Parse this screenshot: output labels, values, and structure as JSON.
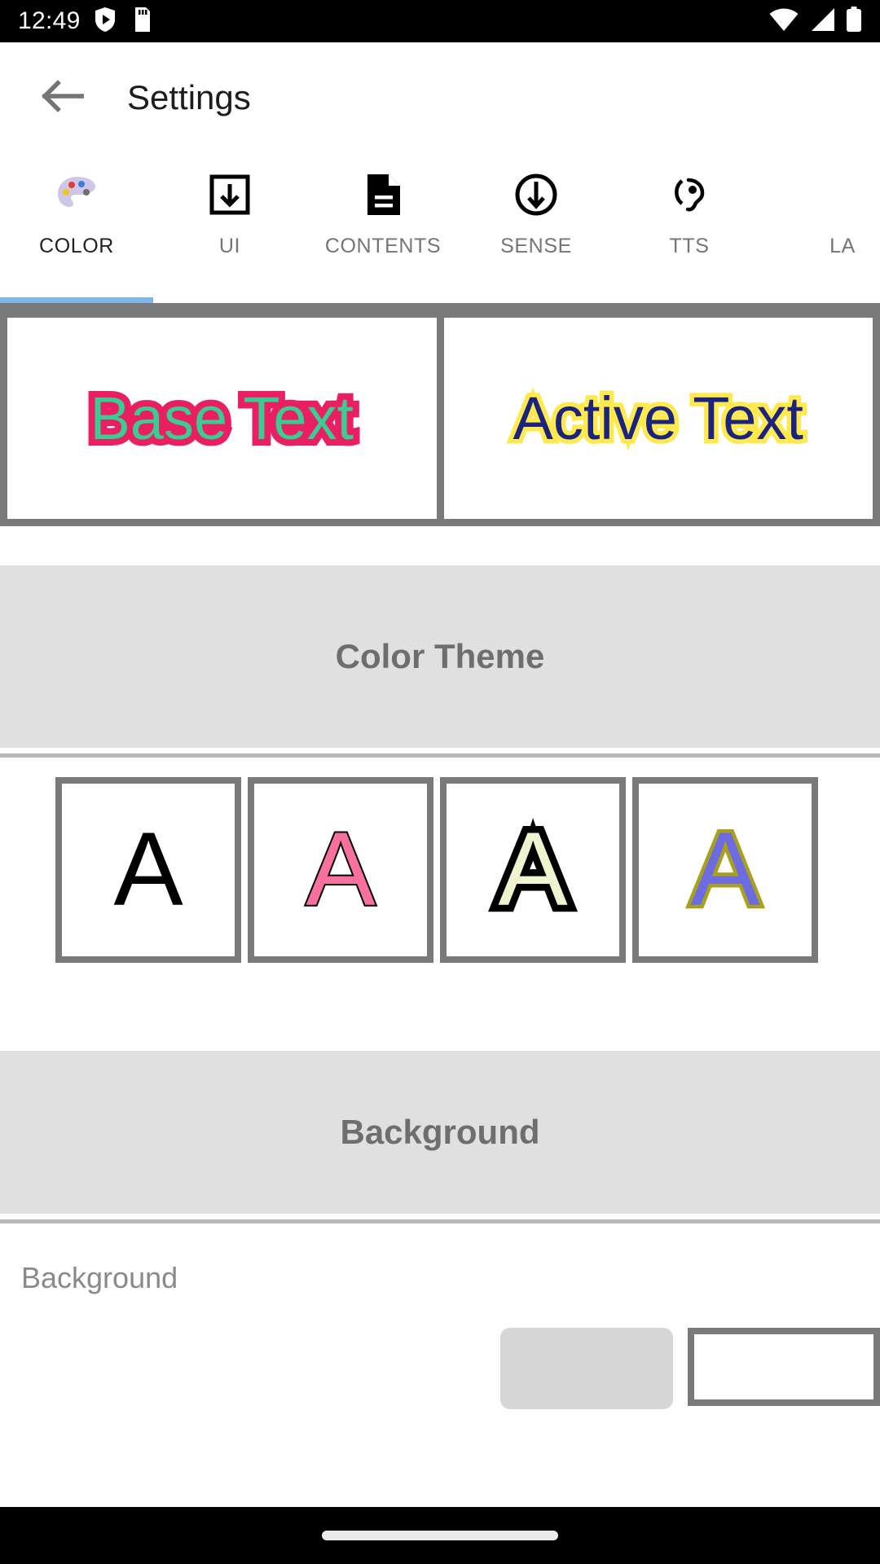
{
  "status_bar": {
    "clock": "12:49",
    "left_icons": [
      "shield-play-icon",
      "sd-card-icon"
    ],
    "right_icons": [
      "wifi-icon",
      "cellular-signal-icon",
      "battery-icon"
    ],
    "background_color": "#000000",
    "foreground_color": "#ffffff"
  },
  "toolbar": {
    "back_icon": "back-arrow-icon",
    "title": "Settings"
  },
  "tabs": {
    "active_index": 0,
    "indicator_color": "#7FB6E8",
    "items": [
      {
        "label": "COLOR",
        "icon": "palette-icon",
        "active": true
      },
      {
        "label": "UI",
        "icon": "download-box-icon",
        "active": false
      },
      {
        "label": "CONTENTS",
        "icon": "document-icon",
        "active": false
      },
      {
        "label": "SENSE",
        "icon": "circle-down-arrow-icon",
        "active": false
      },
      {
        "label": "TTS",
        "icon": "hearing-ear-icon",
        "active": false
      },
      {
        "label": "LA",
        "icon": "",
        "active": false
      }
    ]
  },
  "preview": {
    "base": {
      "text": "Base Text",
      "fill_color": "#3ACC93",
      "outline_color": "#E91E63"
    },
    "active": {
      "text": "Active Text",
      "fill_color": "#1A237E",
      "outline_color": "#FFE94D"
    }
  },
  "color_theme_section": {
    "title": "Color Theme",
    "swatches": [
      {
        "letter": "A",
        "fill_color": "#000000",
        "outline_color": "none",
        "name": "theme-black"
      },
      {
        "letter": "A",
        "fill_color": "#F8719D",
        "outline_color": "#000000",
        "name": "theme-pink"
      },
      {
        "letter": "A",
        "fill_color": "#EFF3CF",
        "outline_color": "#000000",
        "name": "theme-cream"
      },
      {
        "letter": "A",
        "fill_color": "#6C6CE0",
        "outline_color": "#A8A01E",
        "name": "theme-blue"
      }
    ]
  },
  "background_section": {
    "title": "Background",
    "row_label": "Background",
    "button_label": "",
    "chip_label": ""
  },
  "nav_bar": {
    "gesture_pill": "home-gesture-pill"
  }
}
